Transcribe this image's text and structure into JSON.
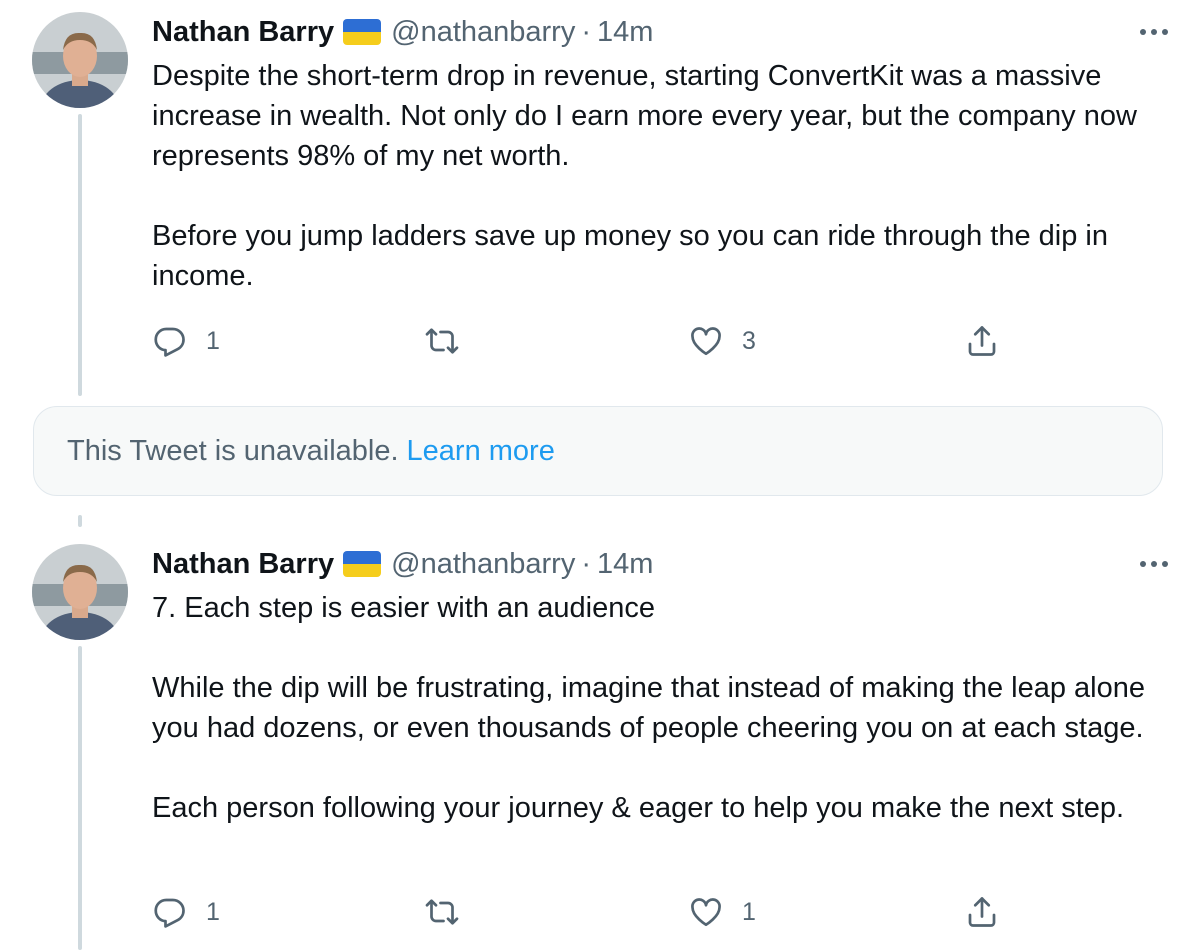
{
  "tweets": [
    {
      "author_name": "Nathan Barry",
      "flag_icon": "ukraine-flag",
      "handle": "@nathanbarry",
      "separator": "·",
      "time": "14m",
      "text": "Despite the short-term drop in revenue, starting ConvertKit was a massive increase in wealth. Not only do I earn more every year, but the company now represents 98% of my net worth.\n\nBefore you jump ladders save up money so you can ride through the dip in income.",
      "reply_count": "1",
      "retweet_count": "",
      "like_count": "3"
    },
    {
      "author_name": "Nathan Barry",
      "flag_icon": "ukraine-flag",
      "handle": "@nathanbarry",
      "separator": "·",
      "time": "14m",
      "text": "7. Each step is easier with an audience\n\nWhile the dip will be frustrating, imagine that instead of making the leap alone you had dozens, or even thousands of people cheering you on at each stage.\n\nEach person following your journey & eager to help you make the next step.",
      "reply_count": "1",
      "retweet_count": "",
      "like_count": "1"
    }
  ],
  "unavailable_notice": {
    "message": "This Tweet is unavailable.",
    "link_label": "Learn more"
  },
  "colors": {
    "text_primary": "#0f1419",
    "text_secondary": "#536471",
    "link": "#1d9bf0",
    "thread_line": "#cfd9de",
    "notice_background": "#f7f9f9"
  }
}
